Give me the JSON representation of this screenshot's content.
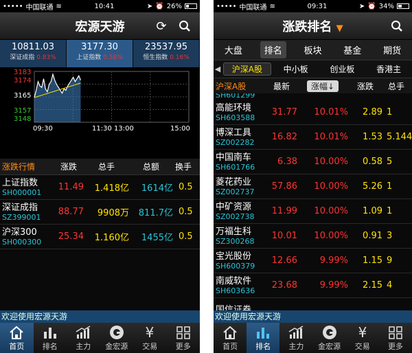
{
  "left": {
    "status": {
      "carrier": "中国联通",
      "time": "10:41",
      "battery": "26%",
      "battery_level": 0.26
    },
    "title": "宏源天游",
    "indices": [
      {
        "value": "10811.03",
        "name": "深证成指",
        "change": "0.83%"
      },
      {
        "value": "3177.30",
        "name": "上证指数",
        "change": "0.58%"
      },
      {
        "value": "23537.95",
        "name": "恒生指数",
        "change": "0.16%"
      }
    ],
    "chart_data": {
      "type": "line",
      "y_ticks": [
        "3183",
        "3174",
        "3165",
        "3157",
        "3148"
      ],
      "y_range": [
        3148,
        3183
      ],
      "x_ticks": [
        "09:30",
        "11:30 13:00",
        "15:00"
      ],
      "series": [
        {
          "values": [
            3165,
            3170,
            3176,
            3173,
            3172,
            3178,
            3171,
            3169,
            3174,
            3176,
            3181,
            3177,
            3174,
            3172,
            3170,
            3168,
            3171,
            3170,
            3173,
            3175,
            3177,
            3179,
            3176,
            3178,
            3180,
            3177
          ]
        }
      ]
    },
    "table": {
      "headers": [
        "涨跌行情",
        "涨跌",
        "总手",
        "总额",
        "换手"
      ],
      "rows": [
        {
          "name": "上证指数",
          "code": "SH000001",
          "change": "11.49",
          "volume": "1.418亿",
          "amount": "1614亿",
          "turnover": "0.5"
        },
        {
          "name": "深证成指",
          "code": "SZ399001",
          "change": "88.77",
          "volume": "9908万",
          "amount": "811.7亿",
          "turnover": "0.5"
        },
        {
          "name": "沪深300",
          "code": "SH000300",
          "change": "25.34",
          "volume": "1.160亿",
          "amount": "1455亿",
          "turnover": "0.5"
        }
      ]
    },
    "welcome": "欢迎使用宏源天游",
    "tabs": [
      "首页",
      "排名",
      "主力",
      "金宏源",
      "交易",
      "更多"
    ]
  },
  "right": {
    "status": {
      "carrier": "中国联通",
      "time": "09:31",
      "battery": "34%",
      "battery_level": 0.34
    },
    "title": "涨跌排名",
    "top_tabs": [
      "大盘",
      "排名",
      "板块",
      "基金",
      "期货"
    ],
    "sub_tabs": [
      "沪深A股",
      "中小板",
      "创业板",
      "香港主"
    ],
    "columns": {
      "market": "沪深A股",
      "latest": "最新",
      "pct": "涨幅↓",
      "change": "涨跌",
      "volume": "总手"
    },
    "partial_code": "SH601299",
    "rows": [
      {
        "name": "高能环境",
        "code": "SH603588",
        "latest": "31.77",
        "pct": "10.01%",
        "change": "2.89",
        "volume": "1"
      },
      {
        "name": "博深工具",
        "code": "SZ002282",
        "latest": "16.82",
        "pct": "10.01%",
        "change": "1.53",
        "volume": "5.144"
      },
      {
        "name": "中国南车",
        "code": "SH601766",
        "latest": "6.38",
        "pct": "10.00%",
        "change": "0.58",
        "volume": "5"
      },
      {
        "name": "菱花药业",
        "code": "SZ002737",
        "latest": "57.86",
        "pct": "10.00%",
        "change": "5.26",
        "volume": "1"
      },
      {
        "name": "中矿资源",
        "code": "SZ002738",
        "latest": "11.99",
        "pct": "10.00%",
        "change": "1.09",
        "volume": "1"
      },
      {
        "name": "万福生科",
        "code": "SZ300268",
        "latest": "10.01",
        "pct": "10.00%",
        "change": "0.91",
        "volume": "3"
      },
      {
        "name": "宝光股份",
        "code": "SH600379",
        "latest": "12.66",
        "pct": "9.99%",
        "change": "1.15",
        "volume": "9"
      },
      {
        "name": "南威软件",
        "code": "SH603636",
        "latest": "23.68",
        "pct": "9.99%",
        "change": "2.15",
        "volume": "4"
      },
      {
        "name": "国信证券",
        "code": "",
        "latest": "",
        "pct": "",
        "change": "",
        "volume": ""
      }
    ],
    "welcome": "欢迎使用宏源天游",
    "tabs": [
      "首页",
      "排名",
      "主力",
      "金宏源",
      "交易",
      "更多"
    ]
  }
}
